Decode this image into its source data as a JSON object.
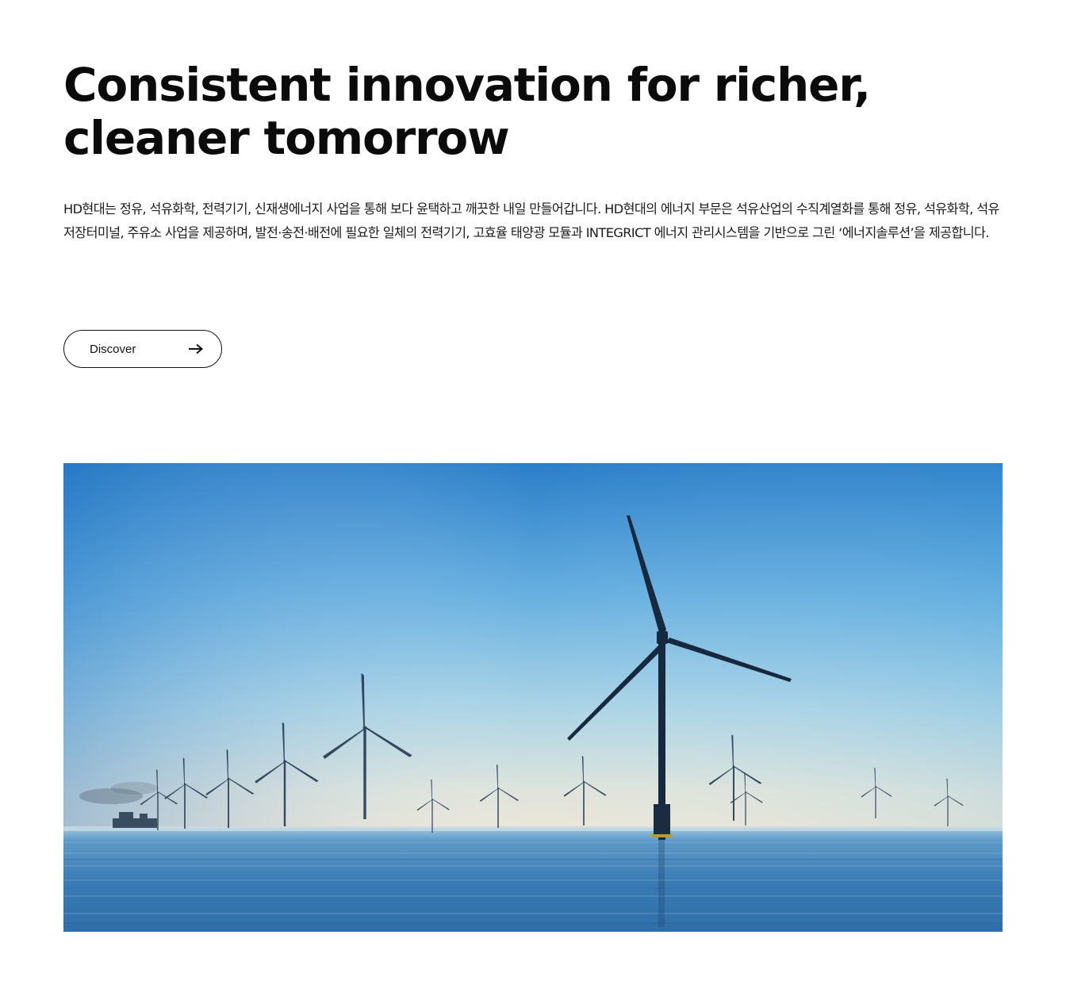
{
  "intro": {
    "headline_line1": "Consistent innovation for richer,",
    "headline_line2": "cleaner tomorrow",
    "description": "HD현대는 정유, 석유화학, 전력기기, 신재생에너지 사업을 통해 보다 윤택하고 깨끗한 내일 만들어갑니다. HD현대의 에너지 부문은 석유산업의 수직계열화를 통해 정유, 석유화학, 석유저장터미널, 주유소 사업을 제공하며, 발전·송전·배전에 필요한 일체의 전력기기, 고효율 태양광 모듈과 INTEGRICT 에너지 관리시스템을 기반으로 그린 ‘에너지솔루션’을 제공합니다."
  },
  "cta": {
    "discover_label": "Discover",
    "arrow_icon": "arrow-right-icon"
  },
  "hero_image": {
    "subject": "offshore-wind-turbines",
    "colors": {
      "sky_top": "#2a7cc8",
      "sky_mid": "#7fbce0",
      "horizon": "#dfe3df",
      "sea": "#3a7bb3",
      "turbine": "#1a2e45"
    }
  }
}
